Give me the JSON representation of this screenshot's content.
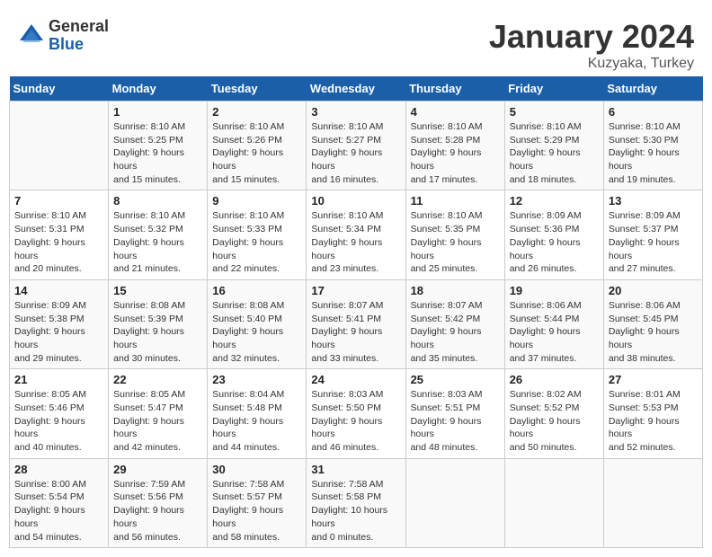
{
  "logo": {
    "general": "General",
    "blue": "Blue"
  },
  "title": "January 2024",
  "subtitle": "Kuzyaka, Turkey",
  "days_of_week": [
    "Sunday",
    "Monday",
    "Tuesday",
    "Wednesday",
    "Thursday",
    "Friday",
    "Saturday"
  ],
  "weeks": [
    [
      {
        "day": "",
        "sunrise": "",
        "sunset": "",
        "daylight": ""
      },
      {
        "day": "1",
        "sunrise": "Sunrise: 8:10 AM",
        "sunset": "Sunset: 5:25 PM",
        "daylight": "Daylight: 9 hours and 15 minutes."
      },
      {
        "day": "2",
        "sunrise": "Sunrise: 8:10 AM",
        "sunset": "Sunset: 5:26 PM",
        "daylight": "Daylight: 9 hours and 15 minutes."
      },
      {
        "day": "3",
        "sunrise": "Sunrise: 8:10 AM",
        "sunset": "Sunset: 5:27 PM",
        "daylight": "Daylight: 9 hours and 16 minutes."
      },
      {
        "day": "4",
        "sunrise": "Sunrise: 8:10 AM",
        "sunset": "Sunset: 5:28 PM",
        "daylight": "Daylight: 9 hours and 17 minutes."
      },
      {
        "day": "5",
        "sunrise": "Sunrise: 8:10 AM",
        "sunset": "Sunset: 5:29 PM",
        "daylight": "Daylight: 9 hours and 18 minutes."
      },
      {
        "day": "6",
        "sunrise": "Sunrise: 8:10 AM",
        "sunset": "Sunset: 5:30 PM",
        "daylight": "Daylight: 9 hours and 19 minutes."
      }
    ],
    [
      {
        "day": "7",
        "sunrise": "Sunrise: 8:10 AM",
        "sunset": "Sunset: 5:31 PM",
        "daylight": "Daylight: 9 hours and 20 minutes."
      },
      {
        "day": "8",
        "sunrise": "Sunrise: 8:10 AM",
        "sunset": "Sunset: 5:32 PM",
        "daylight": "Daylight: 9 hours and 21 minutes."
      },
      {
        "day": "9",
        "sunrise": "Sunrise: 8:10 AM",
        "sunset": "Sunset: 5:33 PM",
        "daylight": "Daylight: 9 hours and 22 minutes."
      },
      {
        "day": "10",
        "sunrise": "Sunrise: 8:10 AM",
        "sunset": "Sunset: 5:34 PM",
        "daylight": "Daylight: 9 hours and 23 minutes."
      },
      {
        "day": "11",
        "sunrise": "Sunrise: 8:10 AM",
        "sunset": "Sunset: 5:35 PM",
        "daylight": "Daylight: 9 hours and 25 minutes."
      },
      {
        "day": "12",
        "sunrise": "Sunrise: 8:09 AM",
        "sunset": "Sunset: 5:36 PM",
        "daylight": "Daylight: 9 hours and 26 minutes."
      },
      {
        "day": "13",
        "sunrise": "Sunrise: 8:09 AM",
        "sunset": "Sunset: 5:37 PM",
        "daylight": "Daylight: 9 hours and 27 minutes."
      }
    ],
    [
      {
        "day": "14",
        "sunrise": "Sunrise: 8:09 AM",
        "sunset": "Sunset: 5:38 PM",
        "daylight": "Daylight: 9 hours and 29 minutes."
      },
      {
        "day": "15",
        "sunrise": "Sunrise: 8:08 AM",
        "sunset": "Sunset: 5:39 PM",
        "daylight": "Daylight: 9 hours and 30 minutes."
      },
      {
        "day": "16",
        "sunrise": "Sunrise: 8:08 AM",
        "sunset": "Sunset: 5:40 PM",
        "daylight": "Daylight: 9 hours and 32 minutes."
      },
      {
        "day": "17",
        "sunrise": "Sunrise: 8:07 AM",
        "sunset": "Sunset: 5:41 PM",
        "daylight": "Daylight: 9 hours and 33 minutes."
      },
      {
        "day": "18",
        "sunrise": "Sunrise: 8:07 AM",
        "sunset": "Sunset: 5:42 PM",
        "daylight": "Daylight: 9 hours and 35 minutes."
      },
      {
        "day": "19",
        "sunrise": "Sunrise: 8:06 AM",
        "sunset": "Sunset: 5:44 PM",
        "daylight": "Daylight: 9 hours and 37 minutes."
      },
      {
        "day": "20",
        "sunrise": "Sunrise: 8:06 AM",
        "sunset": "Sunset: 5:45 PM",
        "daylight": "Daylight: 9 hours and 38 minutes."
      }
    ],
    [
      {
        "day": "21",
        "sunrise": "Sunrise: 8:05 AM",
        "sunset": "Sunset: 5:46 PM",
        "daylight": "Daylight: 9 hours and 40 minutes."
      },
      {
        "day": "22",
        "sunrise": "Sunrise: 8:05 AM",
        "sunset": "Sunset: 5:47 PM",
        "daylight": "Daylight: 9 hours and 42 minutes."
      },
      {
        "day": "23",
        "sunrise": "Sunrise: 8:04 AM",
        "sunset": "Sunset: 5:48 PM",
        "daylight": "Daylight: 9 hours and 44 minutes."
      },
      {
        "day": "24",
        "sunrise": "Sunrise: 8:03 AM",
        "sunset": "Sunset: 5:50 PM",
        "daylight": "Daylight: 9 hours and 46 minutes."
      },
      {
        "day": "25",
        "sunrise": "Sunrise: 8:03 AM",
        "sunset": "Sunset: 5:51 PM",
        "daylight": "Daylight: 9 hours and 48 minutes."
      },
      {
        "day": "26",
        "sunrise": "Sunrise: 8:02 AM",
        "sunset": "Sunset: 5:52 PM",
        "daylight": "Daylight: 9 hours and 50 minutes."
      },
      {
        "day": "27",
        "sunrise": "Sunrise: 8:01 AM",
        "sunset": "Sunset: 5:53 PM",
        "daylight": "Daylight: 9 hours and 52 minutes."
      }
    ],
    [
      {
        "day": "28",
        "sunrise": "Sunrise: 8:00 AM",
        "sunset": "Sunset: 5:54 PM",
        "daylight": "Daylight: 9 hours and 54 minutes."
      },
      {
        "day": "29",
        "sunrise": "Sunrise: 7:59 AM",
        "sunset": "Sunset: 5:56 PM",
        "daylight": "Daylight: 9 hours and 56 minutes."
      },
      {
        "day": "30",
        "sunrise": "Sunrise: 7:58 AM",
        "sunset": "Sunset: 5:57 PM",
        "daylight": "Daylight: 9 hours and 58 minutes."
      },
      {
        "day": "31",
        "sunrise": "Sunrise: 7:58 AM",
        "sunset": "Sunset: 5:58 PM",
        "daylight": "Daylight: 10 hours and 0 minutes."
      },
      {
        "day": "",
        "sunrise": "",
        "sunset": "",
        "daylight": ""
      },
      {
        "day": "",
        "sunrise": "",
        "sunset": "",
        "daylight": ""
      },
      {
        "day": "",
        "sunrise": "",
        "sunset": "",
        "daylight": ""
      }
    ]
  ]
}
